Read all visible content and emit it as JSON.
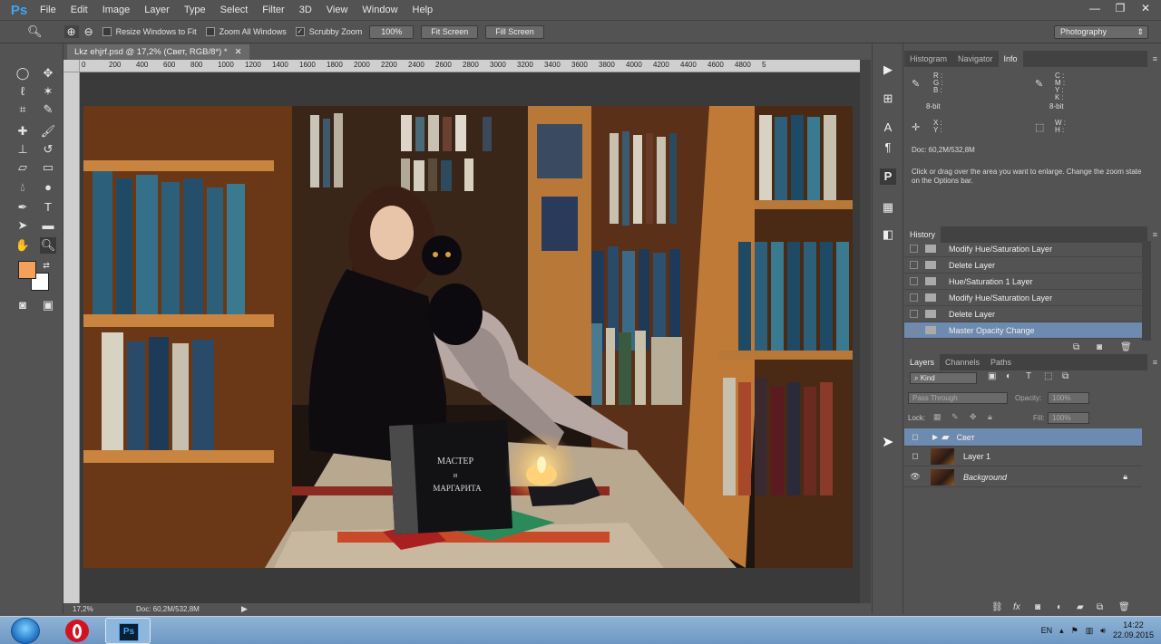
{
  "app": {
    "logo": "Ps",
    "minimize": "—",
    "restore": "❐",
    "close": "✕"
  },
  "menu": [
    "File",
    "Edit",
    "Image",
    "Layer",
    "Type",
    "Select",
    "Filter",
    "3D",
    "View",
    "Window",
    "Help"
  ],
  "options": {
    "resize_windows": "Resize Windows to Fit",
    "zoom_all": "Zoom All Windows",
    "scrubby_zoom": "Scrubby Zoom",
    "zoom_percent": "100%",
    "fit_screen": "Fit Screen",
    "fill_screen": "Fill Screen",
    "workspace": "Photography"
  },
  "document": {
    "tab_title": "Lkz ehjrf.psd @ 17,2% (Свет, RGB/8*) *",
    "ruler_labels": [
      "0",
      "200",
      "400",
      "600",
      "800",
      "1000",
      "1200",
      "1400",
      "1600",
      "1800",
      "2000",
      "2200",
      "2400",
      "2600",
      "2800",
      "3000",
      "3200",
      "3400",
      "3600",
      "3800",
      "4000",
      "4200",
      "4400",
      "4600",
      "4800",
      "5"
    ],
    "zoom": "17,2%",
    "doc_size": "Doc: 60,2M/532,8M"
  },
  "panels": {
    "top_tabs": [
      "Histogram",
      "Navigator",
      "Info"
    ],
    "info": {
      "left_channels": "R :\nG :\nB :",
      "left_bits": "8-bit",
      "right_channels": "C :\nM :\nY :\nK :",
      "right_bits": "8-bit",
      "xy": "X :\nY :",
      "wh": "W :\nH :",
      "doc": "Doc: 60,2M/532,8M",
      "help": "Click or drag over the area you want to enlarge. Change the zoom state on the Options bar."
    },
    "history_title": "History",
    "history": [
      "Modify Hue/Saturation Layer",
      "Delete Layer",
      "Hue/Saturation 1 Layer",
      "Modify Hue/Saturation Layer",
      "Delete Layer",
      "Master Opacity Change"
    ],
    "layers_tabs": [
      "Layers",
      "Channels",
      "Paths"
    ],
    "kind": "Kind",
    "blend_mode": "Pass Through",
    "opacity_label": "Opacity:",
    "opacity_value": "100%",
    "lock_label": "Lock:",
    "fill_label": "Fill:",
    "fill_value": "100%",
    "layers": [
      "Свет",
      "Layer 1",
      "Background"
    ]
  },
  "taskbar": {
    "lang": "EN",
    "time": "14:22",
    "date": "22.09.2015"
  },
  "colors": {
    "foreground": "#f5a05a",
    "background": "#ffffff",
    "selection": "#6d8bb0",
    "ps_blue": "#3ea6f0"
  }
}
